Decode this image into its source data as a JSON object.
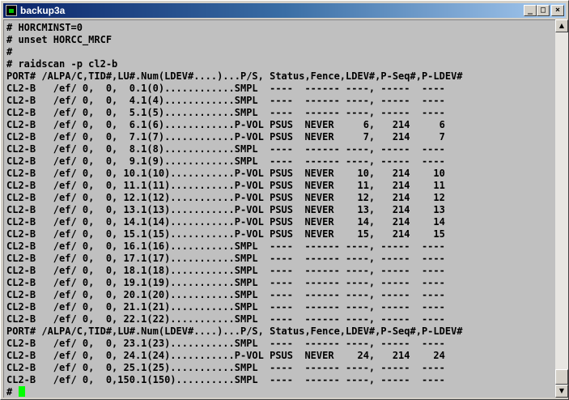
{
  "window": {
    "title": "backup3a",
    "minimize_glyph": "_",
    "maximize_glyph": "□",
    "close_glyph": "×"
  },
  "terminal": {
    "lines": [
      "# HORCMINST=0",
      "# unset HORCC_MRCF",
      "#",
      "# raidscan -p cl2-b",
      "PORT# /ALPA/C,TID#,LU#.Num(LDEV#....)...P/S, Status,Fence,LDEV#,P-Seq#,P-LDEV#",
      "CL2-B   /ef/ 0,  0,  0.1(0)............SMPL  ----  ------ ----, -----  ----",
      "CL2-B   /ef/ 0,  0,  4.1(4)............SMPL  ----  ------ ----, -----  ----",
      "CL2-B   /ef/ 0,  0,  5.1(5)............SMPL  ----  ------ ----, -----  ----",
      "CL2-B   /ef/ 0,  0,  6.1(6)............P-VOL PSUS  NEVER     6,   214     6",
      "CL2-B   /ef/ 0,  0,  7.1(7)............P-VOL PSUS  NEVER     7,   214     7",
      "CL2-B   /ef/ 0,  0,  8.1(8)............SMPL  ----  ------ ----, -----  ----",
      "CL2-B   /ef/ 0,  0,  9.1(9)............SMPL  ----  ------ ----, -----  ----",
      "CL2-B   /ef/ 0,  0, 10.1(10)...........P-VOL PSUS  NEVER    10,   214    10",
      "CL2-B   /ef/ 0,  0, 11.1(11)...........P-VOL PSUS  NEVER    11,   214    11",
      "CL2-B   /ef/ 0,  0, 12.1(12)...........P-VOL PSUS  NEVER    12,   214    12",
      "CL2-B   /ef/ 0,  0, 13.1(13)...........P-VOL PSUS  NEVER    13,   214    13",
      "CL2-B   /ef/ 0,  0, 14.1(14)...........P-VOL PSUS  NEVER    14,   214    14",
      "CL2-B   /ef/ 0,  0, 15.1(15)...........P-VOL PSUS  NEVER    15,   214    15",
      "CL2-B   /ef/ 0,  0, 16.1(16)...........SMPL  ----  ------ ----, -----  ----",
      "CL2-B   /ef/ 0,  0, 17.1(17)...........SMPL  ----  ------ ----, -----  ----",
      "CL2-B   /ef/ 0,  0, 18.1(18)...........SMPL  ----  ------ ----, -----  ----",
      "CL2-B   /ef/ 0,  0, 19.1(19)...........SMPL  ----  ------ ----, -----  ----",
      "CL2-B   /ef/ 0,  0, 20.1(20)...........SMPL  ----  ------ ----, -----  ----",
      "CL2-B   /ef/ 0,  0, 21.1(21)...........SMPL  ----  ------ ----, -----  ----",
      "CL2-B   /ef/ 0,  0, 22.1(22)...........SMPL  ----  ------ ----, -----  ----",
      "PORT# /ALPA/C,TID#,LU#.Num(LDEV#....)...P/S, Status,Fence,LDEV#,P-Seq#,P-LDEV#",
      "CL2-B   /ef/ 0,  0, 23.1(23)...........SMPL  ----  ------ ----, -----  ----",
      "CL2-B   /ef/ 0,  0, 24.1(24)...........P-VOL PSUS  NEVER    24,   214    24",
      "CL2-B   /ef/ 0,  0, 25.1(25)...........SMPL  ----  ------ ----, -----  ----",
      "CL2-B   /ef/ 0,  0,150.1(150)..........SMPL  ----  ------ ----, -----  ----"
    ],
    "prompt": "#",
    "cursor_color": "#00ff00",
    "background_color": "#c0c0c0"
  },
  "scrollbar": {
    "up_glyph": "▲",
    "down_glyph": "▼"
  }
}
